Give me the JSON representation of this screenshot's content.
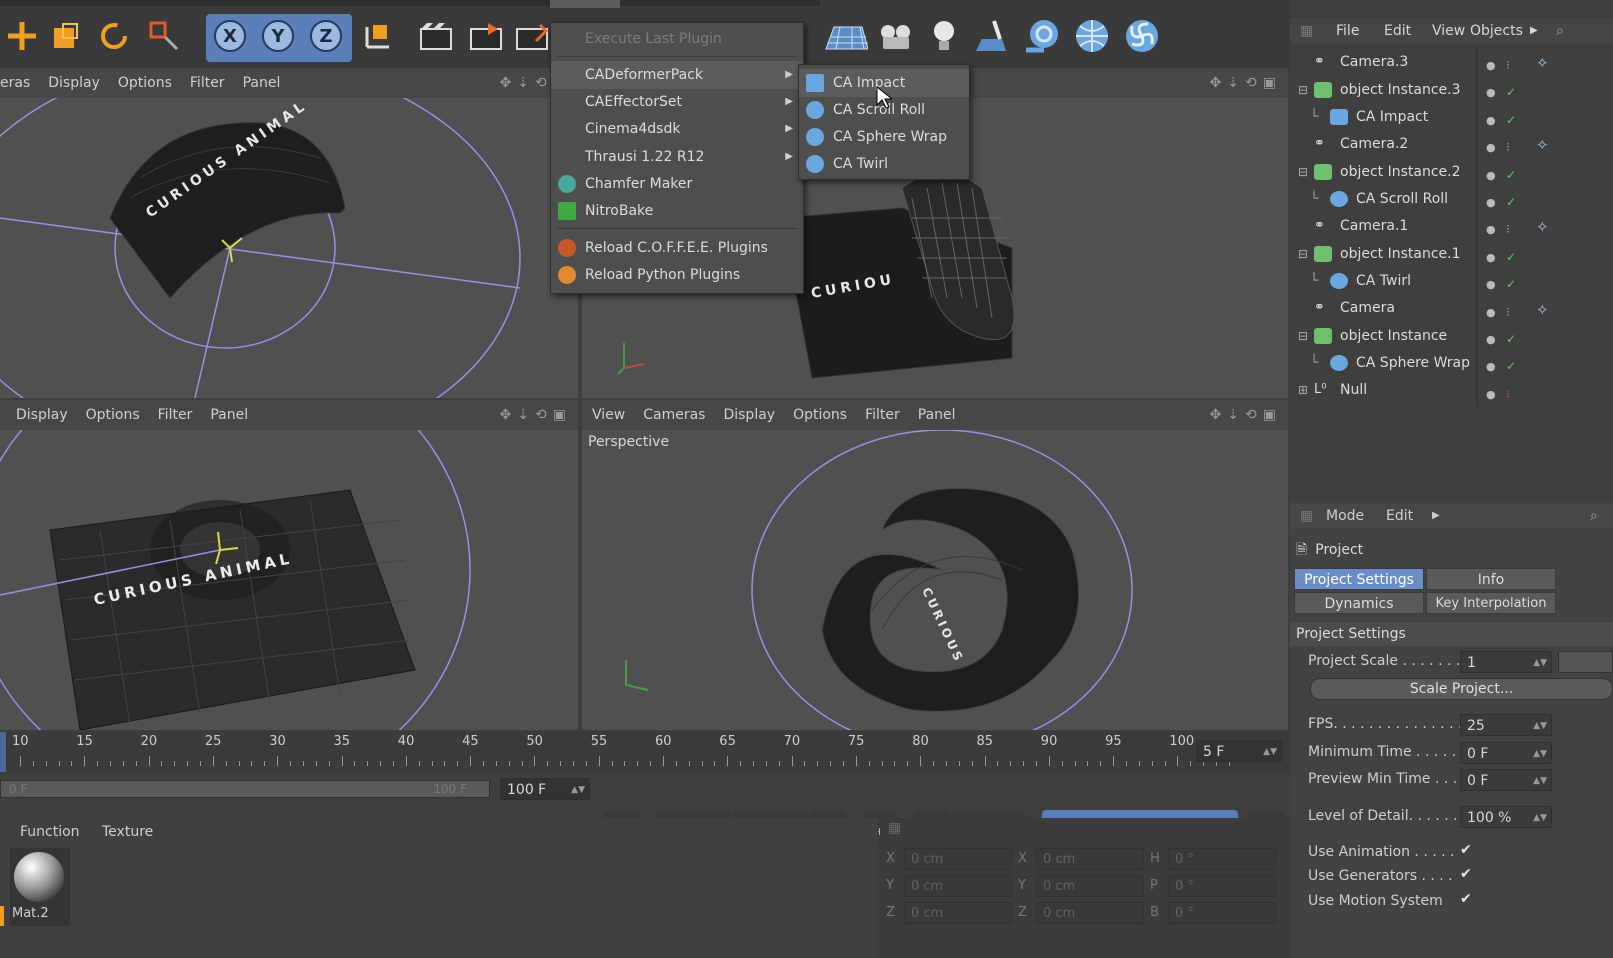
{
  "app": {
    "toolbar": {
      "icons": [
        "move-tool-icon",
        "scale-tool-icon",
        "rotate-tool-icon",
        "live-selection-icon",
        "x-axis-icon",
        "y-axis-icon",
        "z-axis-icon",
        "coordinate-system-icon",
        "render-view-icon",
        "render-to-picture-viewer-icon",
        "render-settings-icon",
        "floor-icon",
        "camera-icon",
        "light-icon",
        "paint-icon",
        "ca-scroll-roll-icon",
        "ca-sphere-wrap-icon",
        "ca-twirl-icon"
      ],
      "axis_x": "X",
      "axis_y": "Y",
      "axis_z": "Z"
    }
  },
  "viewport_top_left": {
    "menu": [
      "eras",
      "Display",
      "Options",
      "Filter",
      "Panel"
    ],
    "label": "CURIOUS ANIMAL"
  },
  "viewport_bottom_left": {
    "menu": [
      "Display",
      "Options",
      "Filter",
      "Panel"
    ]
  },
  "viewport_bottom_right": {
    "menu": [
      "View",
      "Cameras",
      "Display",
      "Options",
      "Filter",
      "Panel"
    ],
    "label": "Perspective"
  },
  "plugins_menu": {
    "items": [
      {
        "label": "Execute Last Plugin",
        "disabled": true
      },
      {
        "label": "CADeformerPack",
        "submenu": true,
        "highlighted": true
      },
      {
        "label": "CAEffectorSet",
        "submenu": true
      },
      {
        "label": "Cinema4dsdk",
        "submenu": true
      },
      {
        "label": "Thrausi 1.22 R12",
        "submenu": true
      },
      {
        "label": "Chamfer Maker",
        "icon": "chamfer-maker-icon"
      },
      {
        "label": "NitroBake",
        "icon": "nitrobake-icon"
      },
      {
        "label": "Reload C.O.F.F.E.E. Plugins",
        "icon": "coffee-icon"
      },
      {
        "label": "Reload Python Plugins",
        "icon": "python-icon"
      }
    ]
  },
  "submenu": {
    "items": [
      {
        "label": "CA Impact",
        "highlighted": true
      },
      {
        "label": "CA Scroll Roll"
      },
      {
        "label": "CA Sphere Wrap"
      },
      {
        "label": "CA Twirl"
      }
    ]
  },
  "object_manager": {
    "menu": [
      "File",
      "Edit",
      "View",
      "Objects"
    ],
    "objects": [
      {
        "name": "Camera.3",
        "indent": 0,
        "type": "camera"
      },
      {
        "name": "object Instance.3",
        "indent": 0,
        "type": "instance",
        "expand": true
      },
      {
        "name": "CA Impact",
        "indent": 1,
        "type": "deformer"
      },
      {
        "name": "Camera.2",
        "indent": 0,
        "type": "camera"
      },
      {
        "name": "object Instance.2",
        "indent": 0,
        "type": "instance",
        "expand": true
      },
      {
        "name": "CA Scroll Roll",
        "indent": 1,
        "type": "deformer"
      },
      {
        "name": "Camera.1",
        "indent": 0,
        "type": "camera"
      },
      {
        "name": "object Instance.1",
        "indent": 0,
        "type": "instance",
        "expand": true
      },
      {
        "name": "CA Twirl",
        "indent": 1,
        "type": "deformer"
      },
      {
        "name": "Camera",
        "indent": 0,
        "type": "camera"
      },
      {
        "name": "object Instance",
        "indent": 0,
        "type": "instance",
        "expand": true
      },
      {
        "name": "CA Sphere Wrap",
        "indent": 1,
        "type": "deformer"
      },
      {
        "name": "Null",
        "indent": 0,
        "type": "null",
        "expand": true
      }
    ]
  },
  "attribute_manager": {
    "menu": [
      "Mode",
      "Edit"
    ],
    "title": "Project",
    "tabs": [
      "Project Settings",
      "Info",
      "Dynamics",
      "Key Interpolation"
    ],
    "section": "Project Settings",
    "project_scale_label": "Project Scale . . . . . . .",
    "project_scale_value": "1",
    "scale_project_button": "Scale Project...",
    "fps_label": "FPS. . . . . . . . . . . . . . . . .",
    "fps_value": "25",
    "min_time_label": "Minimum Time . . . . . .",
    "min_time_value": "0 F",
    "preview_min_label": "Preview Min Time . . .",
    "preview_min_value": "0 F",
    "lod_label": "Level of Detail. . . . . . .",
    "lod_value": "100 %",
    "use_animation_label": "Use Animation . . . . .",
    "use_generators_label": "Use Generators . . . .",
    "use_motion_label": "Use Motion System",
    "check": "✔"
  },
  "timeline": {
    "ticks": [
      "10",
      "15",
      "20",
      "25",
      "30",
      "35",
      "40",
      "45",
      "50",
      "55",
      "60",
      "65",
      "70",
      "75",
      "80",
      "85",
      "90",
      "95",
      "100"
    ],
    "current_frame": "5 F",
    "start": "0 F",
    "end_dim": "100 F",
    "end": "100 F"
  },
  "material_manager": {
    "menu": [
      "Function",
      "Texture"
    ],
    "material": "Mat.2"
  },
  "coordinates": {
    "rows": [
      {
        "a": "X",
        "av": "0 cm",
        "b": "X",
        "bv": "0 cm",
        "c": "H",
        "cv": "0 °"
      },
      {
        "a": "Y",
        "av": "0 cm",
        "b": "Y",
        "bv": "0 cm",
        "c": "P",
        "cv": "0 °"
      },
      {
        "a": "Z",
        "av": "0 cm",
        "b": "Z",
        "bv": "0 cm",
        "c": "B",
        "cv": "0 °"
      }
    ]
  },
  "colors": {
    "accent_orange": "#f0a020",
    "accent_blue": "#6aa7e0",
    "highlight": "#5c5c5c",
    "tab_active": "#6a8cc9"
  }
}
